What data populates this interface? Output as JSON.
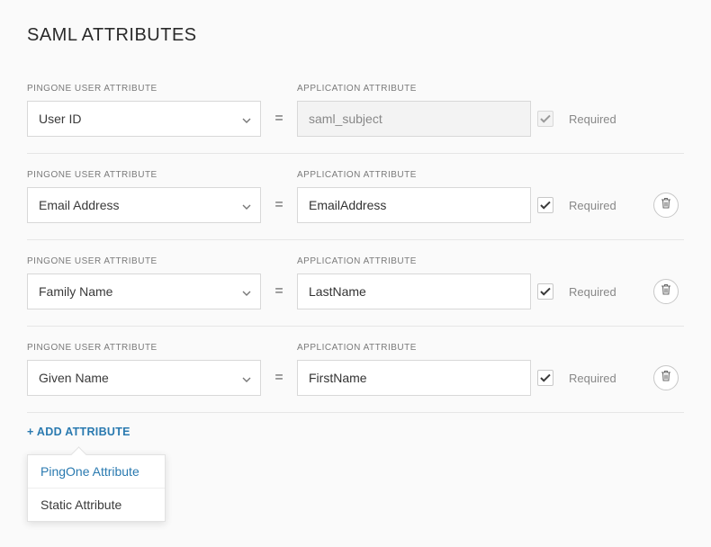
{
  "title": "SAML ATTRIBUTES",
  "labels": {
    "pingone": "PINGONE USER ATTRIBUTE",
    "application": "APPLICATION ATTRIBUTE",
    "required": "Required",
    "equals": "="
  },
  "rows": [
    {
      "pingone": "User ID",
      "application": "saml_subject",
      "locked": true,
      "required": true,
      "deletable": false
    },
    {
      "pingone": "Email Address",
      "application": "EmailAddress",
      "locked": false,
      "required": true,
      "deletable": true
    },
    {
      "pingone": "Family Name",
      "application": "LastName",
      "locked": false,
      "required": true,
      "deletable": true
    },
    {
      "pingone": "Given Name",
      "application": "FirstName",
      "locked": false,
      "required": true,
      "deletable": true
    }
  ],
  "add_attribute": "+ ADD ATTRIBUTE",
  "dropdown": {
    "pingone": "PingOne Attribute",
    "static": "Static Attribute"
  }
}
